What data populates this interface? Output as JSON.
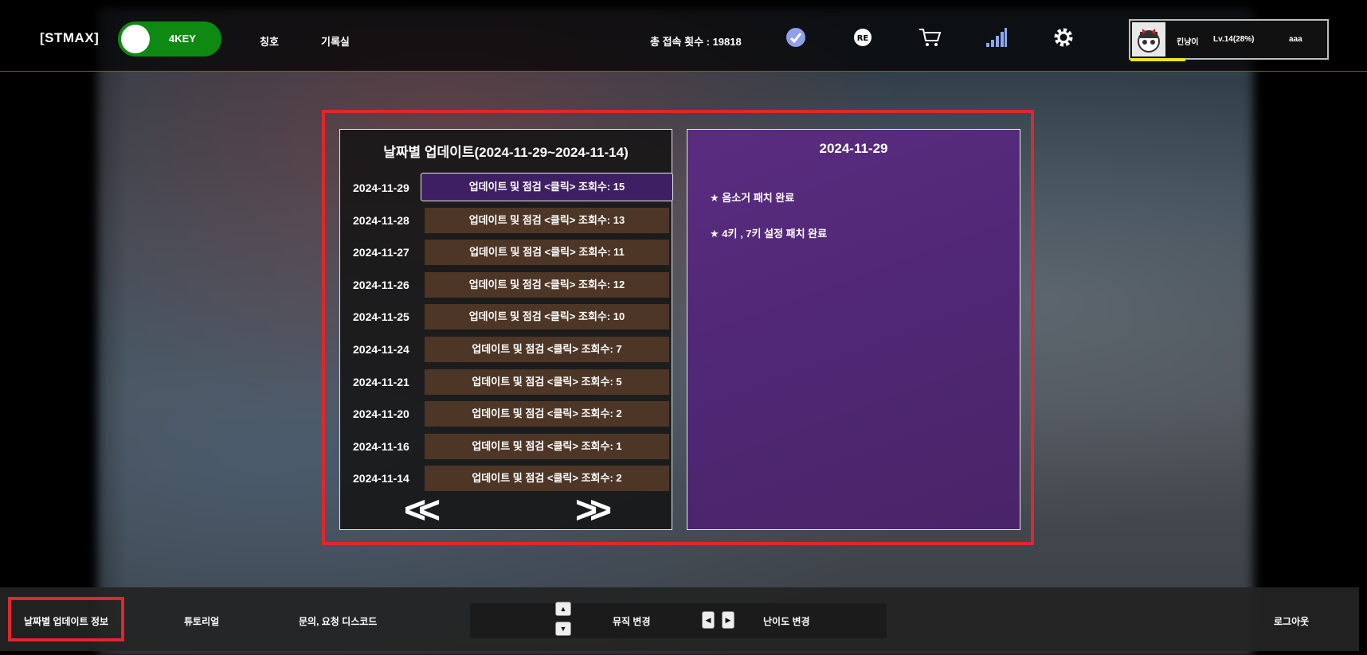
{
  "header": {
    "brand": "[STMAX]",
    "mode_toggle": "4KEY",
    "nav": [
      "칭호",
      "기록실"
    ],
    "visits": "총 접속 횟수 : 19818",
    "icons": [
      "check-badge-icon",
      "replay-icon",
      "cart-icon",
      "signal-bars-icon",
      "gear-icon"
    ],
    "profile": {
      "name": "킨냥이",
      "level": "Lv.14(28%)",
      "user": "aaa",
      "xp_fraction": 0.28
    }
  },
  "updates": {
    "title": "날짜별 업데이트(2024-11-29~2024-11-14)",
    "rows": [
      {
        "date": "2024-11-29",
        "label": "업데이트 및 점검 <클릭> 조회수: 15",
        "active": true
      },
      {
        "date": "2024-11-28",
        "label": "업데이트 및 점검 <클릭> 조회수: 13"
      },
      {
        "date": "2024-11-27",
        "label": "업데이트 및 점검 <클릭> 조회수: 11"
      },
      {
        "date": "2024-11-26",
        "label": "업데이트 및 점검 <클릭> 조회수: 12"
      },
      {
        "date": "2024-11-25",
        "label": "업데이트 및 점검 <클릭> 조회수: 10"
      },
      {
        "date": "2024-11-24",
        "label": "업데이트 및 점검 <클릭> 조회수: 7"
      },
      {
        "date": "2024-11-21",
        "label": "업데이트 및 점검 <클릭> 조회수: 5"
      },
      {
        "date": "2024-11-20",
        "label": "업데이트 및 점검 <클릭> 조회수: 2"
      },
      {
        "date": "2024-11-16",
        "label": "업데이트 및 점검 <클릭> 조회수: 1"
      },
      {
        "date": "2024-11-14",
        "label": "업데이트 및 점검 <클릭> 조회수: 2"
      }
    ],
    "prev_label": "<<",
    "next_label": ">>"
  },
  "detail": {
    "date": "2024-11-29",
    "notes": [
      "★ 음소거 패치 완료",
      "★ 4키 , 7키 설정 패치 완료"
    ]
  },
  "footer": {
    "update_info": "날짜별 업데이트 정보",
    "tutorial": "튜토리얼",
    "discord": "문의, 요청 디스코드",
    "music_change": "뮤직 변경",
    "difficulty_change": "난이도 변경",
    "logout": "로그아웃"
  }
}
